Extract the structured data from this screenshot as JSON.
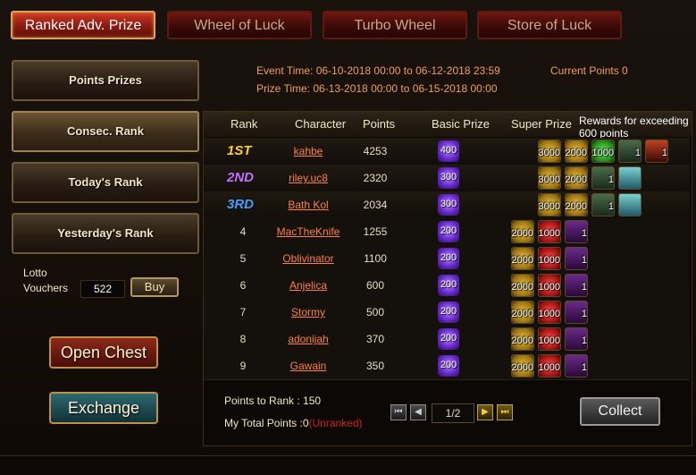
{
  "tabs": [
    "Ranked Adv. Prize",
    "Wheel of Luck",
    "Turbo Wheel",
    "Store of Luck"
  ],
  "sidebar": {
    "items": [
      "Points Prizes",
      "Consec. Rank",
      "Today's Rank",
      "Yesterday's Rank"
    ],
    "lotto_label_1": "Lotto",
    "lotto_label_2": "Vouchers",
    "lotto_value": "522",
    "buy_label": "Buy",
    "open_chest_label": "Open Chest",
    "exchange_label": "Exchange"
  },
  "event": {
    "event_time": "Event Time: 06-10-2018 00:00 to 06-12-2018 23:59",
    "prize_time": "Prize Time: 06-13-2018 00:00 to 06-15-2018 00:00",
    "current_points": "Current Points 0"
  },
  "table": {
    "headers": [
      "Rank",
      "Character",
      "Points",
      "Basic Prize",
      "Super Prize"
    ],
    "reward_note": "Rewards for exceeding 600 points",
    "rows": [
      {
        "rank": "1ST",
        "name": "kahbe",
        "points": "4253",
        "basic": "400",
        "super": [
          [
            "coin",
            "3000"
          ],
          [
            "coin",
            "2000"
          ],
          [
            "green-gem",
            "1000"
          ],
          [
            "armor",
            "1"
          ],
          [
            "portrait",
            "1"
          ]
        ]
      },
      {
        "rank": "2ND",
        "name": "riley.uc8",
        "points": "2320",
        "basic": "300",
        "super": [
          [
            "coin",
            "3000"
          ],
          [
            "coin",
            "2000"
          ],
          [
            "armor",
            "1"
          ],
          [
            "wings",
            ""
          ]
        ]
      },
      {
        "rank": "3RD",
        "name": "Bath Kol",
        "points": "2034",
        "basic": "300",
        "super": [
          [
            "coin",
            "3000"
          ],
          [
            "coin",
            "2000"
          ],
          [
            "armor",
            "1"
          ],
          [
            "wings",
            ""
          ]
        ]
      },
      {
        "rank": "4",
        "name": "MacTheKnife",
        "points": "1255",
        "basic": "200",
        "super": [
          [
            "coin",
            "2000"
          ],
          [
            "red-gem",
            "1000"
          ],
          [
            "scroll",
            "1"
          ]
        ]
      },
      {
        "rank": "5",
        "name": "Oblivinator",
        "points": "1100",
        "basic": "200",
        "super": [
          [
            "coin",
            "2000"
          ],
          [
            "red-gem",
            "1000"
          ],
          [
            "scroll",
            "1"
          ]
        ]
      },
      {
        "rank": "6",
        "name": "Anjelica",
        "points": "600",
        "basic": "200",
        "super": [
          [
            "coin",
            "2000"
          ],
          [
            "red-gem",
            "1000"
          ],
          [
            "scroll",
            "1"
          ]
        ]
      },
      {
        "rank": "7",
        "name": "Stormy",
        "points": "500",
        "basic": "200",
        "super": [
          [
            "coin",
            "2000"
          ],
          [
            "red-gem",
            "1000"
          ],
          [
            "scroll",
            "1"
          ]
        ]
      },
      {
        "rank": "8",
        "name": "adonijah",
        "points": "370",
        "basic": "200",
        "super": [
          [
            "coin",
            "2000"
          ],
          [
            "red-gem",
            "1000"
          ],
          [
            "scroll",
            "1"
          ]
        ]
      },
      {
        "rank": "9",
        "name": "Gawain",
        "points": "350",
        "basic": "200",
        "super": [
          [
            "coin",
            "2000"
          ],
          [
            "red-gem",
            "1000"
          ],
          [
            "scroll",
            "1"
          ]
        ]
      }
    ]
  },
  "rank_colors": {
    "1ST": "#ffd020",
    "2ND": "#c070ff",
    "3RD": "#40a0ff"
  },
  "footer": {
    "points_to_rank": "Points to Rank : 150",
    "my_total_points": "My Total Points :0",
    "unranked": "(Unranked)",
    "page": "1/2",
    "collect_label": "Collect"
  }
}
